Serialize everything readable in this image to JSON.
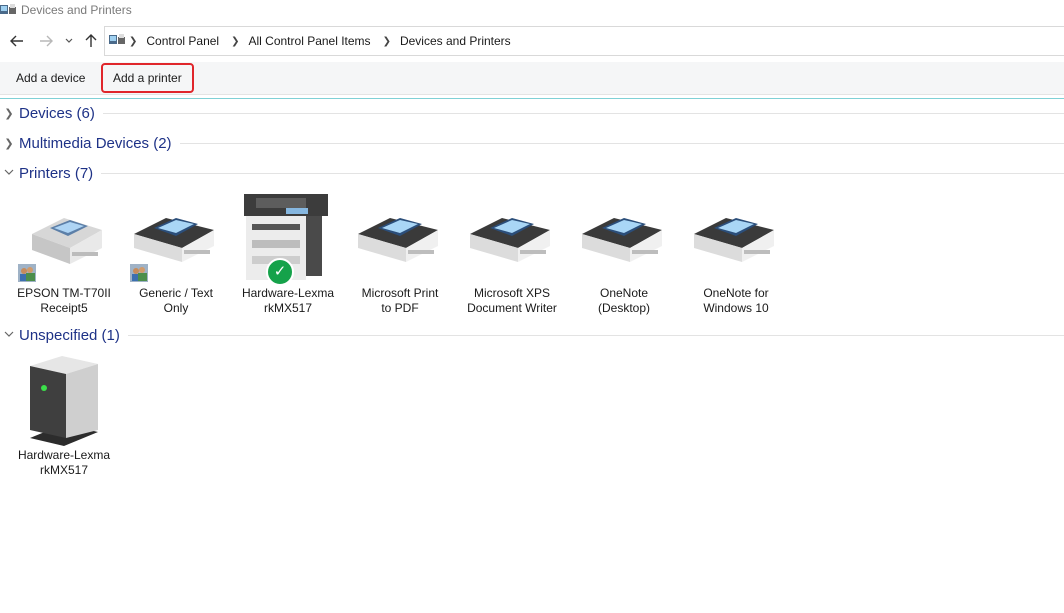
{
  "window": {
    "title": "Devices and Printers"
  },
  "nav": {
    "breadcrumbs": [
      "Control Panel",
      "All Control Panel Items",
      "Devices and Printers"
    ]
  },
  "commands": {
    "add_device": "Add a device",
    "add_printer": "Add a printer"
  },
  "groups": [
    {
      "title": "Devices (6)",
      "expanded": false
    },
    {
      "title": "Multimedia Devices (2)",
      "expanded": false
    },
    {
      "title": "Printers (7)",
      "expanded": true
    },
    {
      "title": "Unspecified (1)",
      "expanded": true
    }
  ],
  "printers": [
    {
      "line1": "EPSON TM-T70II",
      "line2": "Receipt5",
      "shared": true,
      "icon": "printer-gray-icon"
    },
    {
      "line1": "Generic / Text",
      "line2": "Only",
      "shared": true,
      "icon": "printer-icon"
    },
    {
      "line1": "Hardware-Lexma",
      "line2": "rkMX517",
      "default": true,
      "icon": "mfp-printer-icon"
    },
    {
      "line1": "Microsoft Print",
      "line2": "to PDF",
      "icon": "printer-icon"
    },
    {
      "line1": "Microsoft XPS",
      "line2": "Document Writer",
      "icon": "printer-icon"
    },
    {
      "line1": "OneNote",
      "line2": "(Desktop)",
      "icon": "printer-icon"
    },
    {
      "line1": "OneNote for",
      "line2": "Windows 10",
      "icon": "printer-icon"
    }
  ],
  "unspecified": [
    {
      "line1": "Hardware-Lexma",
      "line2": "rkMX517",
      "icon": "server-box-icon"
    }
  ],
  "colors": {
    "highlight": "#e0262b",
    "group_title": "#1e3287",
    "default_check": "#15a24a"
  }
}
